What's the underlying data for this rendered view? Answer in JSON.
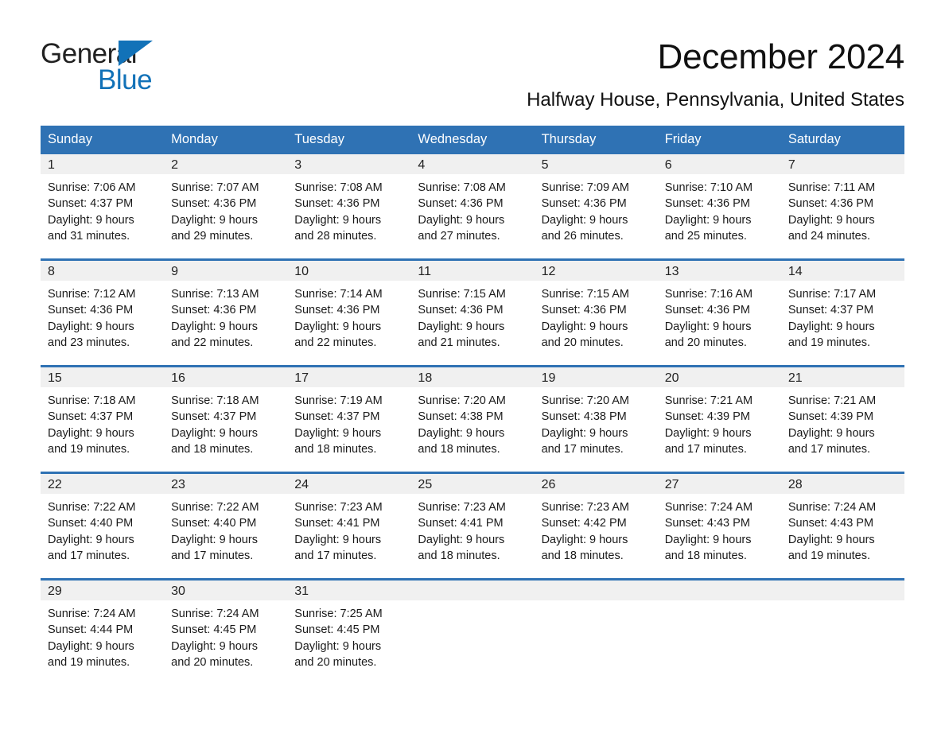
{
  "brand": {
    "name_part1": "General",
    "name_part2": "Blue",
    "accent_color": "#1272b8"
  },
  "header": {
    "month_title": "December 2024",
    "location": "Halfway House, Pennsylvania, United States"
  },
  "theme": {
    "header_blue": "#2f72b4",
    "daynum_band": "#f0f0f0",
    "text": "#1a1a1a"
  },
  "calendar": {
    "columns": [
      "Sunday",
      "Monday",
      "Tuesday",
      "Wednesday",
      "Thursday",
      "Friday",
      "Saturday"
    ],
    "weeks": [
      [
        {
          "day": "1",
          "sunrise": "Sunrise: 7:06 AM",
          "sunset": "Sunset: 4:37 PM",
          "daylight_line1": "Daylight: 9 hours",
          "daylight_line2": "and 31 minutes."
        },
        {
          "day": "2",
          "sunrise": "Sunrise: 7:07 AM",
          "sunset": "Sunset: 4:36 PM",
          "daylight_line1": "Daylight: 9 hours",
          "daylight_line2": "and 29 minutes."
        },
        {
          "day": "3",
          "sunrise": "Sunrise: 7:08 AM",
          "sunset": "Sunset: 4:36 PM",
          "daylight_line1": "Daylight: 9 hours",
          "daylight_line2": "and 28 minutes."
        },
        {
          "day": "4",
          "sunrise": "Sunrise: 7:08 AM",
          "sunset": "Sunset: 4:36 PM",
          "daylight_line1": "Daylight: 9 hours",
          "daylight_line2": "and 27 minutes."
        },
        {
          "day": "5",
          "sunrise": "Sunrise: 7:09 AM",
          "sunset": "Sunset: 4:36 PM",
          "daylight_line1": "Daylight: 9 hours",
          "daylight_line2": "and 26 minutes."
        },
        {
          "day": "6",
          "sunrise": "Sunrise: 7:10 AM",
          "sunset": "Sunset: 4:36 PM",
          "daylight_line1": "Daylight: 9 hours",
          "daylight_line2": "and 25 minutes."
        },
        {
          "day": "7",
          "sunrise": "Sunrise: 7:11 AM",
          "sunset": "Sunset: 4:36 PM",
          "daylight_line1": "Daylight: 9 hours",
          "daylight_line2": "and 24 minutes."
        }
      ],
      [
        {
          "day": "8",
          "sunrise": "Sunrise: 7:12 AM",
          "sunset": "Sunset: 4:36 PM",
          "daylight_line1": "Daylight: 9 hours",
          "daylight_line2": "and 23 minutes."
        },
        {
          "day": "9",
          "sunrise": "Sunrise: 7:13 AM",
          "sunset": "Sunset: 4:36 PM",
          "daylight_line1": "Daylight: 9 hours",
          "daylight_line2": "and 22 minutes."
        },
        {
          "day": "10",
          "sunrise": "Sunrise: 7:14 AM",
          "sunset": "Sunset: 4:36 PM",
          "daylight_line1": "Daylight: 9 hours",
          "daylight_line2": "and 22 minutes."
        },
        {
          "day": "11",
          "sunrise": "Sunrise: 7:15 AM",
          "sunset": "Sunset: 4:36 PM",
          "daylight_line1": "Daylight: 9 hours",
          "daylight_line2": "and 21 minutes."
        },
        {
          "day": "12",
          "sunrise": "Sunrise: 7:15 AM",
          "sunset": "Sunset: 4:36 PM",
          "daylight_line1": "Daylight: 9 hours",
          "daylight_line2": "and 20 minutes."
        },
        {
          "day": "13",
          "sunrise": "Sunrise: 7:16 AM",
          "sunset": "Sunset: 4:36 PM",
          "daylight_line1": "Daylight: 9 hours",
          "daylight_line2": "and 20 minutes."
        },
        {
          "day": "14",
          "sunrise": "Sunrise: 7:17 AM",
          "sunset": "Sunset: 4:37 PM",
          "daylight_line1": "Daylight: 9 hours",
          "daylight_line2": "and 19 minutes."
        }
      ],
      [
        {
          "day": "15",
          "sunrise": "Sunrise: 7:18 AM",
          "sunset": "Sunset: 4:37 PM",
          "daylight_line1": "Daylight: 9 hours",
          "daylight_line2": "and 19 minutes."
        },
        {
          "day": "16",
          "sunrise": "Sunrise: 7:18 AM",
          "sunset": "Sunset: 4:37 PM",
          "daylight_line1": "Daylight: 9 hours",
          "daylight_line2": "and 18 minutes."
        },
        {
          "day": "17",
          "sunrise": "Sunrise: 7:19 AM",
          "sunset": "Sunset: 4:37 PM",
          "daylight_line1": "Daylight: 9 hours",
          "daylight_line2": "and 18 minutes."
        },
        {
          "day": "18",
          "sunrise": "Sunrise: 7:20 AM",
          "sunset": "Sunset: 4:38 PM",
          "daylight_line1": "Daylight: 9 hours",
          "daylight_line2": "and 18 minutes."
        },
        {
          "day": "19",
          "sunrise": "Sunrise: 7:20 AM",
          "sunset": "Sunset: 4:38 PM",
          "daylight_line1": "Daylight: 9 hours",
          "daylight_line2": "and 17 minutes."
        },
        {
          "day": "20",
          "sunrise": "Sunrise: 7:21 AM",
          "sunset": "Sunset: 4:39 PM",
          "daylight_line1": "Daylight: 9 hours",
          "daylight_line2": "and 17 minutes."
        },
        {
          "day": "21",
          "sunrise": "Sunrise: 7:21 AM",
          "sunset": "Sunset: 4:39 PM",
          "daylight_line1": "Daylight: 9 hours",
          "daylight_line2": "and 17 minutes."
        }
      ],
      [
        {
          "day": "22",
          "sunrise": "Sunrise: 7:22 AM",
          "sunset": "Sunset: 4:40 PM",
          "daylight_line1": "Daylight: 9 hours",
          "daylight_line2": "and 17 minutes."
        },
        {
          "day": "23",
          "sunrise": "Sunrise: 7:22 AM",
          "sunset": "Sunset: 4:40 PM",
          "daylight_line1": "Daylight: 9 hours",
          "daylight_line2": "and 17 minutes."
        },
        {
          "day": "24",
          "sunrise": "Sunrise: 7:23 AM",
          "sunset": "Sunset: 4:41 PM",
          "daylight_line1": "Daylight: 9 hours",
          "daylight_line2": "and 17 minutes."
        },
        {
          "day": "25",
          "sunrise": "Sunrise: 7:23 AM",
          "sunset": "Sunset: 4:41 PM",
          "daylight_line1": "Daylight: 9 hours",
          "daylight_line2": "and 18 minutes."
        },
        {
          "day": "26",
          "sunrise": "Sunrise: 7:23 AM",
          "sunset": "Sunset: 4:42 PM",
          "daylight_line1": "Daylight: 9 hours",
          "daylight_line2": "and 18 minutes."
        },
        {
          "day": "27",
          "sunrise": "Sunrise: 7:24 AM",
          "sunset": "Sunset: 4:43 PM",
          "daylight_line1": "Daylight: 9 hours",
          "daylight_line2": "and 18 minutes."
        },
        {
          "day": "28",
          "sunrise": "Sunrise: 7:24 AM",
          "sunset": "Sunset: 4:43 PM",
          "daylight_line1": "Daylight: 9 hours",
          "daylight_line2": "and 19 minutes."
        }
      ],
      [
        {
          "day": "29",
          "sunrise": "Sunrise: 7:24 AM",
          "sunset": "Sunset: 4:44 PM",
          "daylight_line1": "Daylight: 9 hours",
          "daylight_line2": "and 19 minutes."
        },
        {
          "day": "30",
          "sunrise": "Sunrise: 7:24 AM",
          "sunset": "Sunset: 4:45 PM",
          "daylight_line1": "Daylight: 9 hours",
          "daylight_line2": "and 20 minutes."
        },
        {
          "day": "31",
          "sunrise": "Sunrise: 7:25 AM",
          "sunset": "Sunset: 4:45 PM",
          "daylight_line1": "Daylight: 9 hours",
          "daylight_line2": "and 20 minutes."
        },
        {
          "day": "",
          "sunrise": "",
          "sunset": "",
          "daylight_line1": "",
          "daylight_line2": ""
        },
        {
          "day": "",
          "sunrise": "",
          "sunset": "",
          "daylight_line1": "",
          "daylight_line2": ""
        },
        {
          "day": "",
          "sunrise": "",
          "sunset": "",
          "daylight_line1": "",
          "daylight_line2": ""
        },
        {
          "day": "",
          "sunrise": "",
          "sunset": "",
          "daylight_line1": "",
          "daylight_line2": ""
        }
      ]
    ]
  }
}
